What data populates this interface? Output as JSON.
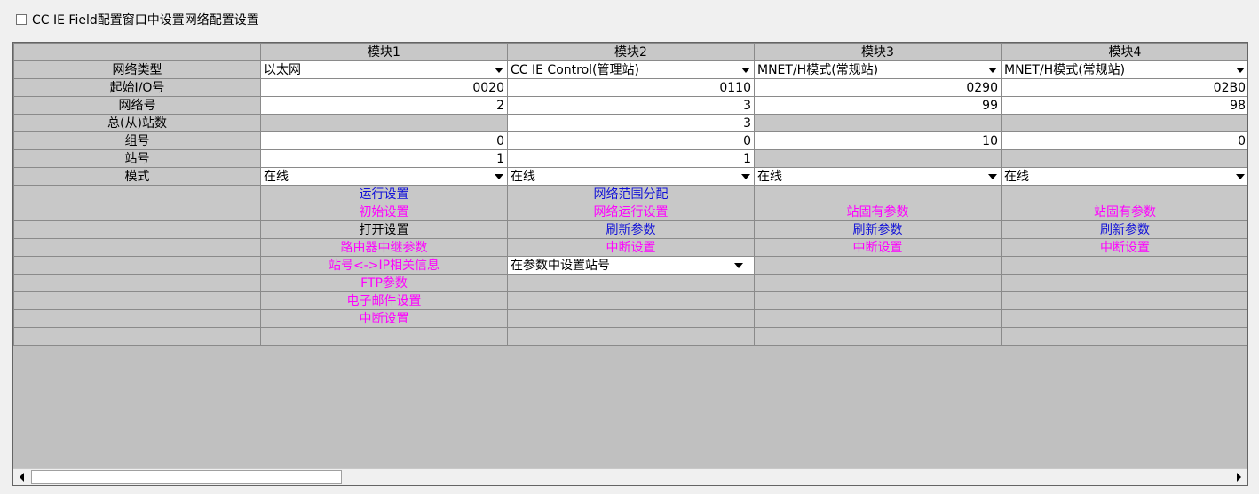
{
  "top_checkbox": {
    "label": "CC IE Field配置窗口中设置网络配置设置",
    "checked": false
  },
  "headers": [
    "",
    "模块1",
    "模块2",
    "模块3",
    "模块4"
  ],
  "rows": {
    "network_type": {
      "label": "网络类型",
      "values": [
        "以太网",
        "CC IE Control(管理站)",
        "MNET/H模式(常规站)",
        "MNET/H模式(常规站)"
      ]
    },
    "start_io": {
      "label": "起始I/O号",
      "values": [
        "0020",
        "0110",
        "0290",
        "02B0"
      ]
    },
    "network_no": {
      "label": "网络号",
      "values": [
        "2",
        "3",
        "99",
        "98"
      ]
    },
    "total_stations": {
      "label": "总(从)站数",
      "values": [
        "",
        "3",
        "",
        ""
      ]
    },
    "group_no": {
      "label": "组号",
      "values": [
        "0",
        "0",
        "10",
        "0"
      ]
    },
    "station_no": {
      "label": "站号",
      "values": [
        "1",
        "1",
        "",
        ""
      ]
    },
    "mode": {
      "label": "模式",
      "values": [
        "在线",
        "在线",
        "在线",
        "在线"
      ]
    }
  },
  "buttons": {
    "r1": [
      "运行设置",
      "网络范围分配",
      "",
      ""
    ],
    "r2": [
      "初始设置",
      "网络运行设置",
      "站固有参数",
      "站固有参数"
    ],
    "r3": [
      "打开设置",
      "刷新参数",
      "刷新参数",
      "刷新参数"
    ],
    "r4": [
      "路由器中继参数",
      "中断设置",
      "中断设置",
      "中断设置"
    ],
    "r5": [
      "站号<->IP相关信息",
      "在参数中设置站号",
      "",
      ""
    ],
    "r6": [
      "FTP参数",
      "",
      "",
      ""
    ],
    "r7": [
      "电子邮件设置",
      "",
      "",
      ""
    ],
    "r8": [
      "中断设置",
      "",
      "",
      ""
    ]
  },
  "colors": {
    "link_blue": "#1010d8",
    "link_pink": "#ff00ff",
    "cell_gray": "#c8c8c8"
  },
  "icons": {
    "scroll_left": "triangle-left-icon",
    "scroll_right": "triangle-right-icon",
    "dropdown": "chevron-down-icon"
  }
}
